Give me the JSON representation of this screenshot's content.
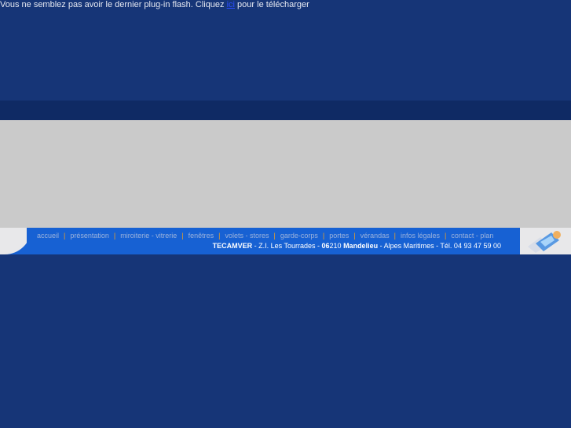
{
  "flash_notice": {
    "before": "Vous ne semblez pas avoir le dernier plug-in flash. Cliquez ",
    "link": "ici",
    "after": " pour le télécharger"
  },
  "nav": [
    "accueil",
    "présentation",
    "miroiterie - vitrerie",
    "fenêtres",
    "volets - stores",
    "garde-corps",
    "portes",
    "vérandas",
    "infos légales",
    "contact - plan"
  ],
  "address": {
    "company": "TECAMVER",
    "street": " - Z.I. Les Tourrades - ",
    "zip_bold": "06",
    "zip_rest": "210 ",
    "city": "Mandelieu",
    "rest": " - Alpes Maritimes - Tél. 04 93 47 59 00"
  },
  "colors": {
    "background": "#163577",
    "bar": "#1761d3",
    "grey": "#cacaca"
  },
  "logo": "glass-logo"
}
